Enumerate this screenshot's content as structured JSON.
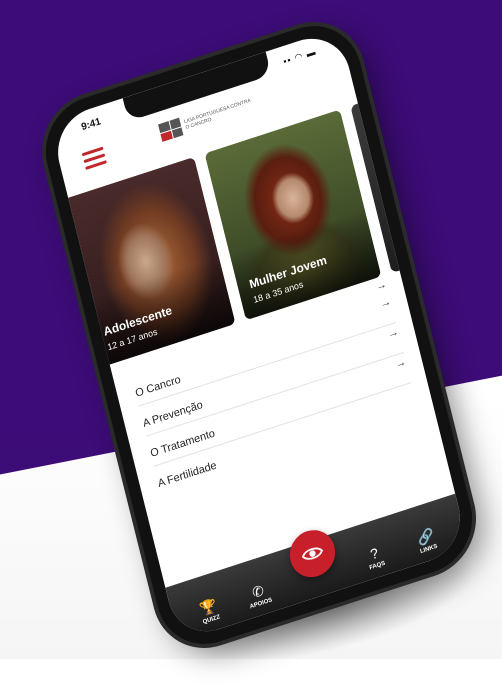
{
  "status_bar": {
    "time": "9:41",
    "icons": "▪▪ ◠ ▬"
  },
  "header": {
    "logo_text": "LIGA PORTUGUESA CONTRA O CANCRO"
  },
  "cards": [
    {
      "title": "Adolescente",
      "subtitle": "12 a 17 anos"
    },
    {
      "title": "Mulher Jovem",
      "subtitle": "18 a 35 anos"
    }
  ],
  "menu": {
    "arrow": "→",
    "items": [
      {
        "label": ""
      },
      {
        "label": "O Cancro"
      },
      {
        "label": "A Prevenção"
      },
      {
        "label": "O Tratamento"
      },
      {
        "label": "A Fertilidade"
      }
    ]
  },
  "bottom_nav": {
    "quizz": "QUIZZ",
    "apoios": "APOIOS",
    "faqs": "FAQS",
    "links": "LINKS"
  },
  "colors": {
    "brand_red": "#c0282d",
    "purple_bg": "#3d0c78"
  }
}
